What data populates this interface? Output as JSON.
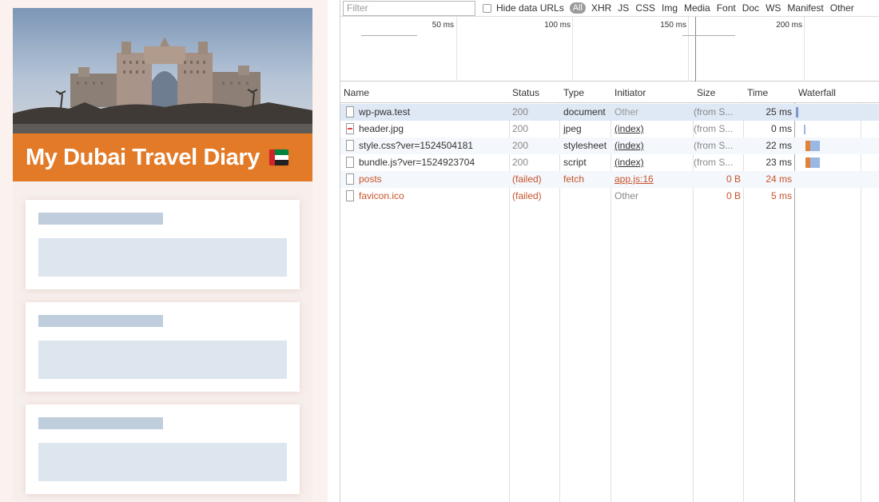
{
  "site": {
    "title": "My Dubai Travel Diary",
    "flag_icon": "uae-flag-icon",
    "accent_color": "#e37a27",
    "cards": 3
  },
  "devtools": {
    "filter_placeholder": "Filter",
    "hide_data_urls_label": "Hide data URLs",
    "filter_types": [
      "All",
      "XHR",
      "JS",
      "CSS",
      "Img",
      "Media",
      "Font",
      "Doc",
      "WS",
      "Manifest",
      "Other"
    ],
    "active_filter": "All",
    "timeline_labels": [
      "50 ms",
      "100 ms",
      "150 ms",
      "200 ms"
    ],
    "columns": [
      "Name",
      "Status",
      "Type",
      "Initiator",
      "Size",
      "Time",
      "Waterfall"
    ],
    "rows": [
      {
        "name": "wp-pwa.test",
        "status": "200",
        "type": "document",
        "initiator": "Other",
        "size": "(from S...",
        "time": "25 ms",
        "failed": false,
        "selected": true
      },
      {
        "name": "header.jpg",
        "status": "200",
        "type": "jpeg",
        "initiator": "(index)",
        "size": "(from S...",
        "time": "0 ms",
        "failed": false
      },
      {
        "name": "style.css?ver=1524504181",
        "status": "200",
        "type": "stylesheet",
        "initiator": "(index)",
        "size": "(from S...",
        "time": "22 ms",
        "failed": false
      },
      {
        "name": "bundle.js?ver=1524923704",
        "status": "200",
        "type": "script",
        "initiator": "(index)",
        "size": "(from S...",
        "time": "23 ms",
        "failed": false
      },
      {
        "name": "posts",
        "status": "(failed)",
        "type": "fetch",
        "initiator": "app.js:16",
        "size": "0 B",
        "time": "24 ms",
        "failed": true
      },
      {
        "name": "favicon.ico",
        "status": "(failed)",
        "type": "",
        "initiator": "Other",
        "size": "0 B",
        "time": "5 ms",
        "failed": true
      }
    ],
    "failed_color": "#c8532b",
    "selected_row_color": "#dfe8f5"
  }
}
